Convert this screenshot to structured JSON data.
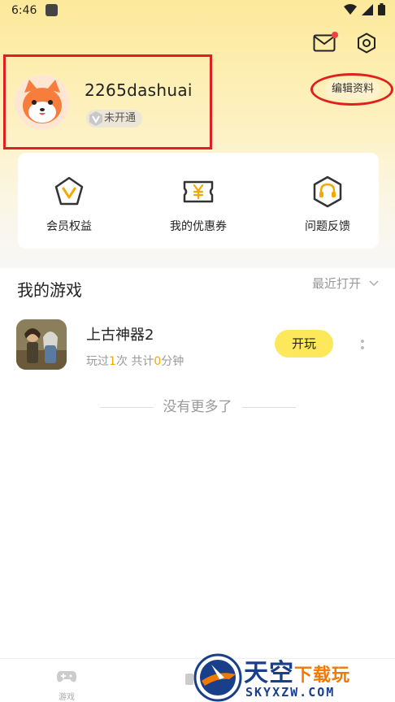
{
  "status_bar": {
    "time": "6:46"
  },
  "profile": {
    "username": "2265dashuai",
    "vip_status": "未开通",
    "edit_label": "编辑资料"
  },
  "quick_actions": [
    {
      "label": "会员权益",
      "icon": "vip-v-icon"
    },
    {
      "label": "我的优惠券",
      "icon": "coupon-yen-icon"
    },
    {
      "label": "问题反馈",
      "icon": "headset-icon"
    }
  ],
  "my_games": {
    "title": "我的游戏",
    "sort_label": "最近打开",
    "games": [
      {
        "name": "上古神器2",
        "meta_prefix": "玩过",
        "times": "1",
        "meta_mid": "次 共计",
        "minutes": "0",
        "meta_suffix": "分钟",
        "play_label": "开玩"
      }
    ],
    "end_text": "没有更多了"
  },
  "tabbar": {
    "games_label": "游戏"
  },
  "watermark": {
    "title": "天空",
    "title_accent": "下载玩",
    "url": "SKYXZW.COM"
  },
  "colors": {
    "accent_yellow": "#fce85a",
    "highlight": "#f2a900",
    "annotation_red": "#e02020"
  }
}
